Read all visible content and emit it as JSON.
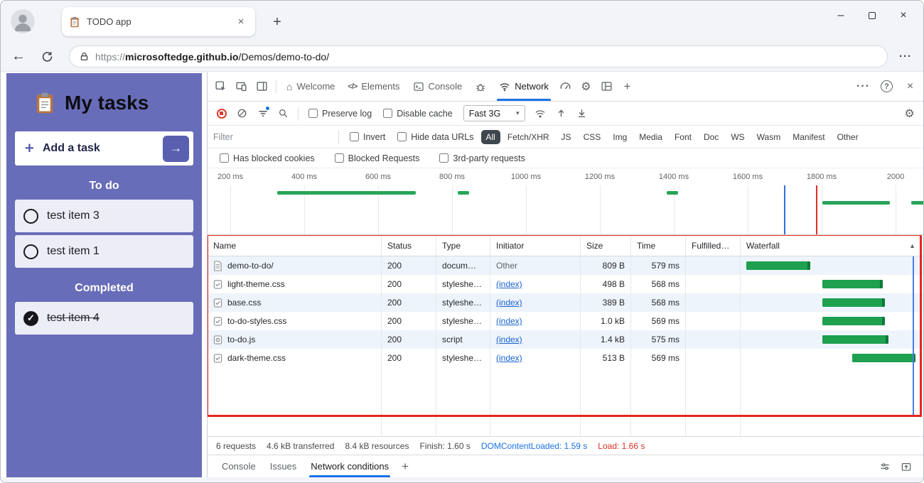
{
  "colors": {
    "accent_blue": "#1a73e8",
    "todo_purple": "#686db9",
    "waterfall_green": "#1ea04f",
    "annotation_red": "#e6261f",
    "dcl_blue": "#1a73e8",
    "load_red": "#d93025",
    "link_blue": "#1a63d0"
  },
  "chrome": {
    "tab_title": "TODO app",
    "url_scheme": "https://",
    "url_host": "microsoftedge.github.io",
    "url_path": "/Demos/demo-to-do/",
    "icons": {
      "close": "×",
      "new_tab": "+",
      "back": "←",
      "more": "···",
      "minimize": "–"
    }
  },
  "todo": {
    "title": "My tasks",
    "add_label": "Add a task",
    "plus_icon": "+",
    "arrow_icon": "→",
    "check_icon": "✓",
    "sections": {
      "todo": "To do",
      "completed": "Completed"
    },
    "items": [
      {
        "text": "test item 3"
      },
      {
        "text": "test item 1"
      }
    ],
    "completed": [
      {
        "text": "test item 4"
      }
    ]
  },
  "devtools": {
    "tabbar": {
      "welcome": "Welcome",
      "elements": "Elements",
      "console": "Console",
      "network": "Network",
      "home_icon": "⌂",
      "code_icon": "</>",
      "add": "+",
      "more": "···",
      "help": "?",
      "close": "×",
      "gear_icon": "⚙"
    },
    "nettoolbar": {
      "preserve_log": "Preserve log",
      "disable_cache": "Disable cache",
      "throttling": "Fast 3G",
      "caret": "▾",
      "gear_icon": "⚙"
    },
    "filters": {
      "placeholder": "Filter",
      "invert": "Invert",
      "hide_data_urls": "Hide data URLs",
      "pills": [
        "All",
        "Fetch/XHR",
        "JS",
        "CSS",
        "Img",
        "Media",
        "Font",
        "Doc",
        "WS",
        "Wasm",
        "Manifest",
        "Other"
      ],
      "checks": [
        "Has blocked cookies",
        "Blocked Requests",
        "3rd-party requests"
      ]
    },
    "overview": {
      "ticks": [
        "200 ms",
        "400 ms",
        "600 ms",
        "800 ms",
        "1000 ms",
        "1200 ms",
        "1400 ms",
        "1600 ms",
        "1800 ms",
        "2000"
      ],
      "bars": [
        {
          "style": "left:98px;width:195px;top:32px"
        },
        {
          "style": "left:352px;width:16px;top:32px"
        },
        {
          "style": "left:646px;width:16px;top:32px"
        },
        {
          "style": "left:865px;width:95px;top:46px"
        },
        {
          "style": "left:990px;width:18px;top:46px"
        }
      ],
      "dcl_line": "left:811px",
      "load_line": "left:856px"
    },
    "table": {
      "columns": [
        "Name",
        "Status",
        "Type",
        "Initiator",
        "Size",
        "Time",
        "Fulfilled…",
        "Waterfall"
      ],
      "sort_icon": "▲",
      "dcl_line": "left:992px",
      "rows": [
        {
          "name": "demo-to-do/",
          "status": "200",
          "type": "docum…",
          "initiator": "Other",
          "size": "809 B",
          "time": "579 ms",
          "bar": "left:8px;width:90px"
        },
        {
          "name": "light-theme.css",
          "status": "200",
          "type": "styleshe…",
          "initiator": "(index)",
          "size": "498 B",
          "time": "568 ms",
          "bar": "left:115px;width:85px"
        },
        {
          "name": "base.css",
          "status": "200",
          "type": "styleshe…",
          "initiator": "(index)",
          "size": "389 B",
          "time": "568 ms",
          "bar": "left:115px;width:88px"
        },
        {
          "name": "to-do-styles.css",
          "status": "200",
          "type": "styleshe…",
          "initiator": "(index)",
          "size": "1.0 kB",
          "time": "569 ms",
          "bar": "left:115px;width:88px"
        },
        {
          "name": "to-do.js",
          "status": "200",
          "type": "script",
          "initiator": "(index)",
          "size": "1.4 kB",
          "time": "575 ms",
          "bar": "left:115px;width:93px"
        },
        {
          "name": "dark-theme.css",
          "status": "200",
          "type": "styleshe…",
          "initiator": "(index)",
          "size": "513 B",
          "time": "569 ms",
          "bar": "left:157px;width:89px"
        }
      ]
    },
    "summary": {
      "requests": "6 requests",
      "transferred": "4.6 kB transferred",
      "resources": "8.4 kB resources",
      "finish": "Finish: 1.60 s",
      "dcl": "DOMContentLoaded: 1.59 s",
      "load": "Load: 1.66 s"
    },
    "drawer": {
      "tabs": [
        "Console",
        "Issues",
        "Network conditions"
      ],
      "add": "+"
    }
  }
}
